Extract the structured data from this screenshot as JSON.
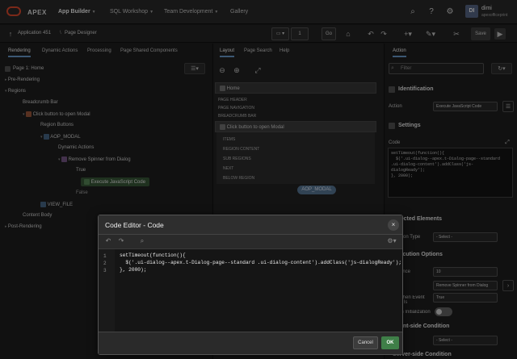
{
  "topnav": {
    "brand": "APEX",
    "items": [
      "App Builder",
      "SQL Workshop",
      "Team Development",
      "Gallery"
    ],
    "user_initials": "DI",
    "user_name": "dimi",
    "user_workspace": "apexofficeprint"
  },
  "toolbar": {
    "app_label": "Application 451",
    "page_designer_label": "Page Designer",
    "page_number": "1",
    "go_label": "Go",
    "save_label": "Save"
  },
  "left_panel": {
    "tabs": [
      "Rendering",
      "Dynamic Actions",
      "Processing",
      "Page Shared Components"
    ],
    "tree": [
      "Page 1: Home",
      "Pre-Rendering",
      "Regions",
      "Breadcrumb Bar",
      "Click button to open Modal",
      "Region Buttons",
      "AOP_MODAL",
      "Dynamic Actions",
      "Remove Spinner from Dialog",
      "True",
      "Execute JavaScript Code",
      "False",
      "VIEW_FILE",
      "Content Body",
      "Post-Rendering"
    ]
  },
  "mid_panel": {
    "tabs": [
      "Layout",
      "Page Search",
      "Help"
    ],
    "home_label": "Home",
    "labels": [
      "PAGE HEADER",
      "PAGE NAVIGATION",
      "BREADCRUMB BAR"
    ],
    "region_title": "Click button to open Modal",
    "region_items": [
      "ITEMS",
      "REGION CONTENT",
      "SUB REGIONS",
      "NEXT",
      "BELOW REGION"
    ],
    "aop_modal": "AOP_MODAL"
  },
  "right_panel": {
    "tab": "Action",
    "filter_placeholder": "Filter",
    "identification": "Identification",
    "action_label": "Action",
    "action_value": "Execute JavaScript Code",
    "settings": "Settings",
    "code_label": "Code",
    "code_preview": "setTimeout(function(){\n  $('.ui-dialog--apex.t-Dialog-page--standard\n.ui-dialog-content').addClass('js-\ndialogReady');\n}, 2000);",
    "affected_elements": "Affected Elements",
    "selection_type": "Selection Type",
    "select_placeholder": "- Select -",
    "execution_options": "Execution Options",
    "sequence_label": "Sequence",
    "sequence_value": "10",
    "event_value": "Remove Spinner from Dialog",
    "fire_when": "Fire When Event Result Is",
    "fire_value": "True",
    "fire_init": "Fire on Initialization",
    "server_condition": "Client-side Condition",
    "select_2": "- Select -",
    "server_side": "Server-side Condition"
  },
  "modal": {
    "title": "Code Editor - Code",
    "lines": [
      "setTimeout(function(){",
      "  $('.ui-dialog--apex.t-Dialog-page--standard .ui-dialog-content').addClass('js-dialogReady');",
      "}, 2000);"
    ],
    "line_numbers": [
      "1",
      "2",
      "3"
    ],
    "cancel_label": "Cancel",
    "ok_label": "OK"
  },
  "colors": {
    "accent": "#6ea0d4",
    "ok_green": "#3f7f48",
    "logo_red": "#e04b2f"
  }
}
